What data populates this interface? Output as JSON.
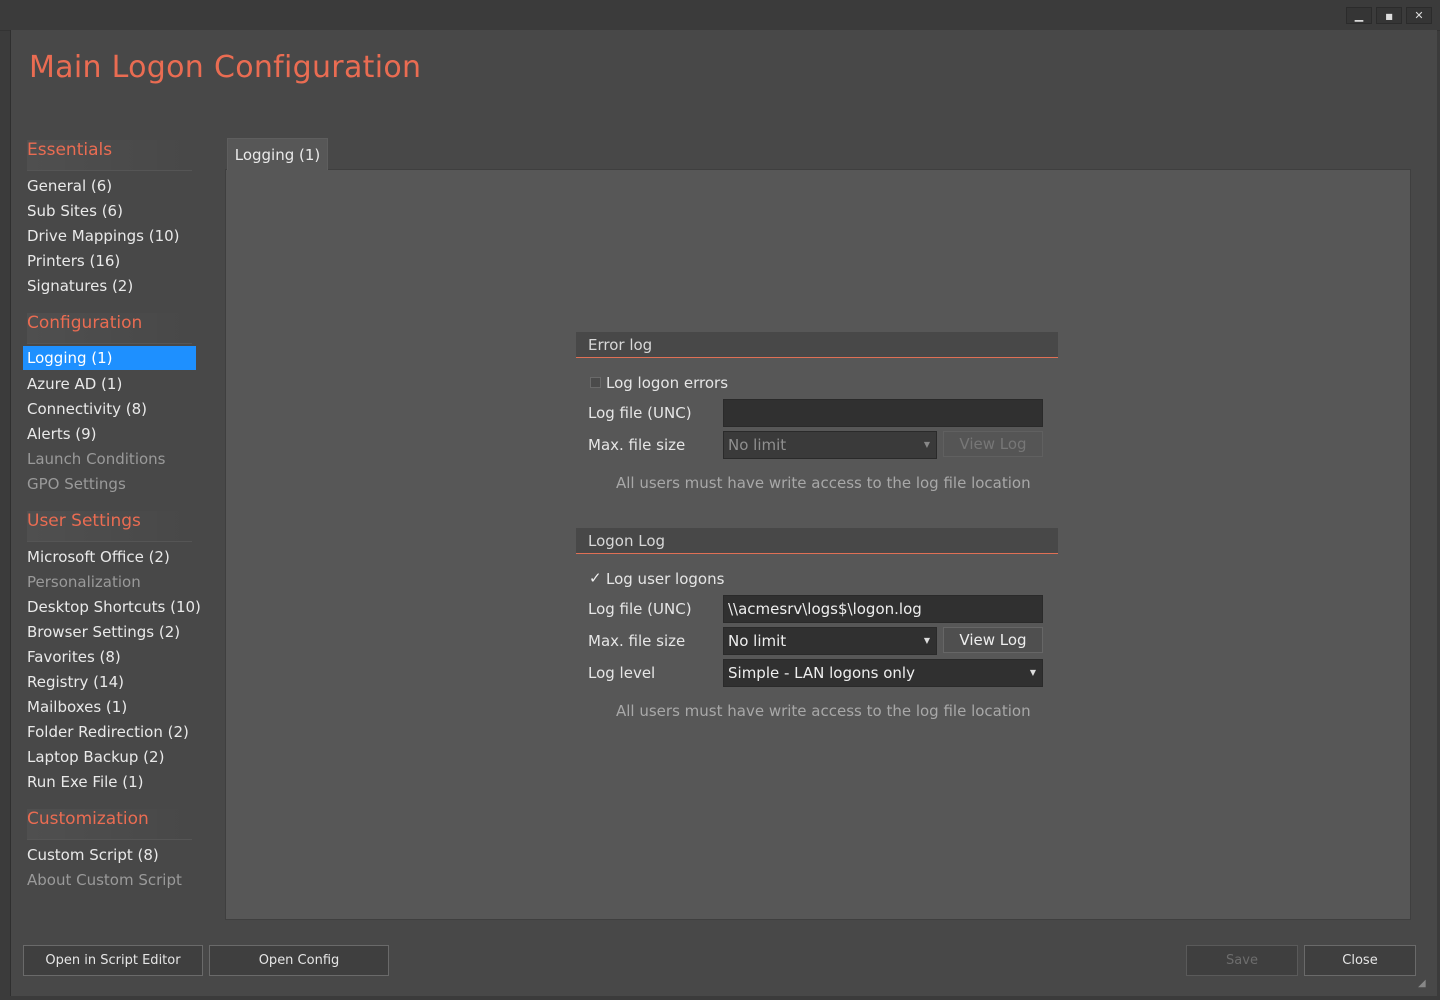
{
  "window": {
    "title": "Main Logon Configuration",
    "controls": {
      "minimize": "▁",
      "maximize": "■",
      "close": "✕"
    }
  },
  "colors": {
    "accent": "#ea6c52",
    "selection": "#1e90ff",
    "background": "#484848"
  },
  "sidebar": {
    "sections": [
      {
        "title": "Essentials",
        "items": [
          {
            "label": "General (6)",
            "state": "normal"
          },
          {
            "label": "Sub Sites (6)",
            "state": "normal"
          },
          {
            "label": "Drive Mappings (10)",
            "state": "normal"
          },
          {
            "label": "Printers (16)",
            "state": "normal"
          },
          {
            "label": "Signatures (2)",
            "state": "normal"
          }
        ]
      },
      {
        "title": "Configuration",
        "items": [
          {
            "label": "Logging (1)",
            "state": "active"
          },
          {
            "label": "Azure AD (1)",
            "state": "normal"
          },
          {
            "label": "Connectivity (8)",
            "state": "normal"
          },
          {
            "label": "Alerts (9)",
            "state": "normal"
          },
          {
            "label": "Launch Conditions",
            "state": "disabled"
          },
          {
            "label": "GPO Settings",
            "state": "disabled"
          }
        ]
      },
      {
        "title": "User Settings",
        "items": [
          {
            "label": "Microsoft Office (2)",
            "state": "normal"
          },
          {
            "label": "Personalization",
            "state": "disabled"
          },
          {
            "label": "Desktop Shortcuts (10)",
            "state": "normal"
          },
          {
            "label": "Browser Settings (2)",
            "state": "normal"
          },
          {
            "label": "Favorites (8)",
            "state": "normal"
          },
          {
            "label": "Registry (14)",
            "state": "normal"
          },
          {
            "label": "Mailboxes (1)",
            "state": "normal"
          },
          {
            "label": "Folder Redirection (2)",
            "state": "normal"
          },
          {
            "label": "Laptop Backup (2)",
            "state": "normal"
          },
          {
            "label": "Run Exe File (1)",
            "state": "normal"
          }
        ]
      },
      {
        "title": "Customization",
        "items": [
          {
            "label": "Custom Script (8)",
            "state": "normal"
          },
          {
            "label": "About Custom Script",
            "state": "disabled"
          }
        ]
      }
    ]
  },
  "tabs": [
    {
      "label": "Logging (1)",
      "active": true
    }
  ],
  "error_log": {
    "title": "Error log",
    "checkbox_label": "Log logon errors",
    "checked": false,
    "file_label": "Log file (UNC)",
    "file_value": "",
    "size_label": "Max. file size",
    "size_value": "No limit",
    "view_button": "View Log",
    "note": "All users must have write access to the log file location"
  },
  "logon_log": {
    "title": "Logon Log",
    "checkbox_label": "Log user logons",
    "checked": true,
    "file_label": "Log file (UNC)",
    "file_value": "\\\\acmesrv\\logs$\\logon.log",
    "size_label": "Max. file size",
    "size_value": "No limit",
    "view_button": "View Log",
    "level_label": "Log level",
    "level_value": "Simple - LAN logons only",
    "note": "All users must have write access to the log file location"
  },
  "footer": {
    "open_script_editor": "Open in Script Editor",
    "open_config": "Open Config",
    "save": "Save",
    "close": "Close"
  }
}
